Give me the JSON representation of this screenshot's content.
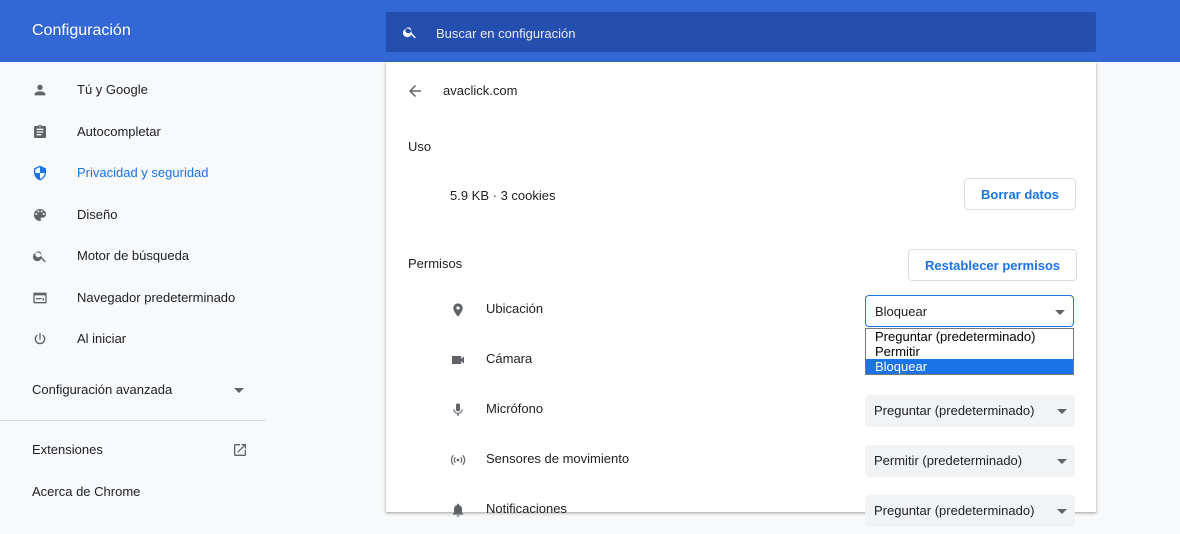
{
  "app": {
    "title": "Configuración"
  },
  "search": {
    "placeholder": "Buscar en configuración"
  },
  "sidebar": {
    "items": [
      {
        "label": "Tú y Google",
        "icon": "person-icon"
      },
      {
        "label": "Autocompletar",
        "icon": "clipboard-icon"
      },
      {
        "label": "Privacidad y seguridad",
        "icon": "shield-icon",
        "active": true
      },
      {
        "label": "Diseño",
        "icon": "palette-icon"
      },
      {
        "label": "Motor de búsqueda",
        "icon": "search-icon"
      },
      {
        "label": "Navegador predeterminado",
        "icon": "browser-icon"
      },
      {
        "label": "Al iniciar",
        "icon": "power-icon"
      }
    ],
    "advanced": "Configuración avanzada",
    "extensions": "Extensiones",
    "about": "Acerca de Chrome"
  },
  "site": {
    "name": "avaclick.com",
    "usage_label": "Uso",
    "usage_text": "5.9 KB · 3 cookies",
    "clear_button": "Borrar datos",
    "permissions_label": "Permisos",
    "reset_button": "Restablecer permisos"
  },
  "permissions": [
    {
      "label": "Ubicación",
      "icon": "location-pin-icon",
      "value": "Bloquear"
    },
    {
      "label": "Cámara",
      "icon": "camera-icon",
      "value": ""
    },
    {
      "label": "Micrófono",
      "icon": "microphone-icon",
      "value": "Preguntar (predeterminado)"
    },
    {
      "label": "Sensores de movimiento",
      "icon": "motion-sensor-icon",
      "value": "Permitir (predeterminado)"
    },
    {
      "label": "Notificaciones",
      "icon": "bell-icon",
      "value": "Preguntar (predeterminado)"
    }
  ],
  "dropdown": {
    "options": [
      "Preguntar (predeterminado)",
      "Permitir",
      "Bloquear"
    ],
    "selected": "Bloquear"
  },
  "colors": {
    "header": "#3367d6",
    "search_bg": "#254fae",
    "accent": "#1a73e8"
  }
}
